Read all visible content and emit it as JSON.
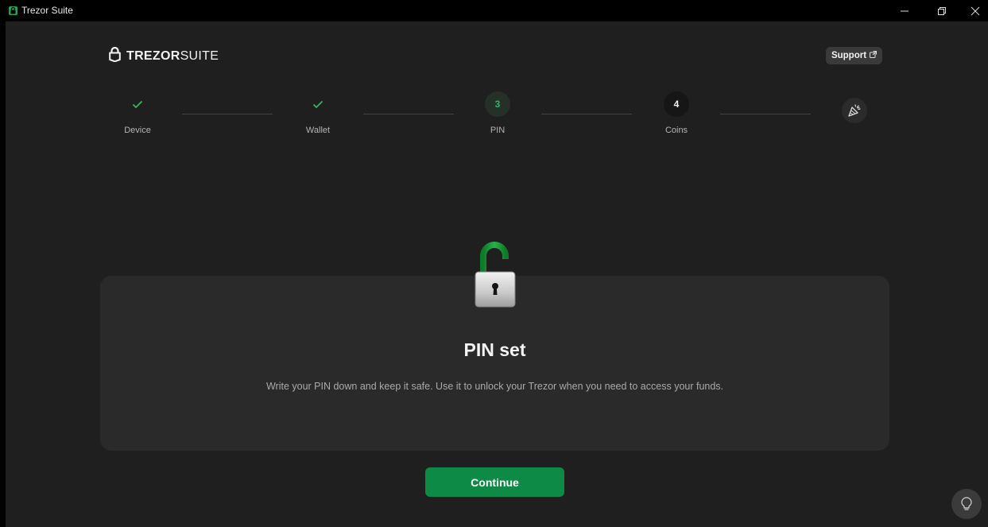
{
  "window": {
    "title": "Trezor Suite"
  },
  "header": {
    "brand_main": "TREZOR",
    "brand_suite": "SUITE",
    "support_label": "Support"
  },
  "steps": [
    {
      "label": "Device",
      "state": "done",
      "marker": "✓"
    },
    {
      "label": "Wallet",
      "state": "done",
      "marker": "✓"
    },
    {
      "label": "PIN",
      "state": "active",
      "marker": "3"
    },
    {
      "label": "Coins",
      "state": "upcoming",
      "marker": "4"
    },
    {
      "label": "",
      "state": "final",
      "marker": "party-popper-icon"
    }
  ],
  "card": {
    "title": "PIN set",
    "description": "Write your PIN down and keep it safe. Use it to unlock your Trezor when you need to access your funds."
  },
  "continue_label": "Continue",
  "colors": {
    "accent_green": "#0d8a45",
    "check_green": "#2fb864",
    "background": "#1f1f1f",
    "card": "#2a2a2a"
  }
}
